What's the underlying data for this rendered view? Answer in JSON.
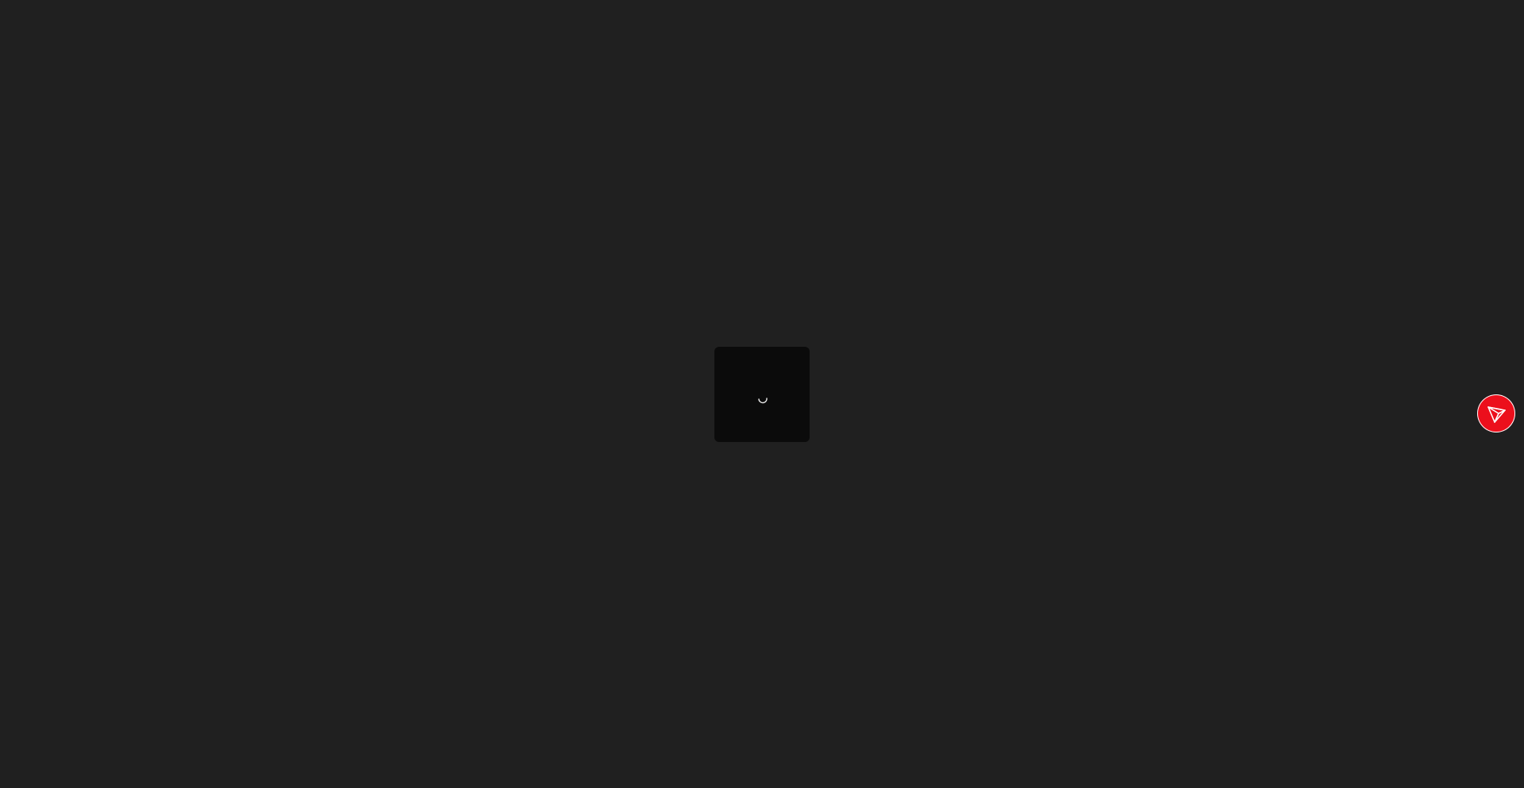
{
  "loading": {
    "indicator_icon": "spinner-icon"
  },
  "wallet_widget": {
    "icon": "tron-logo-icon",
    "accent_color": "#ec0f1c"
  },
  "colors": {
    "page_background": "#202020",
    "loader_background": "#0b0b0b"
  }
}
